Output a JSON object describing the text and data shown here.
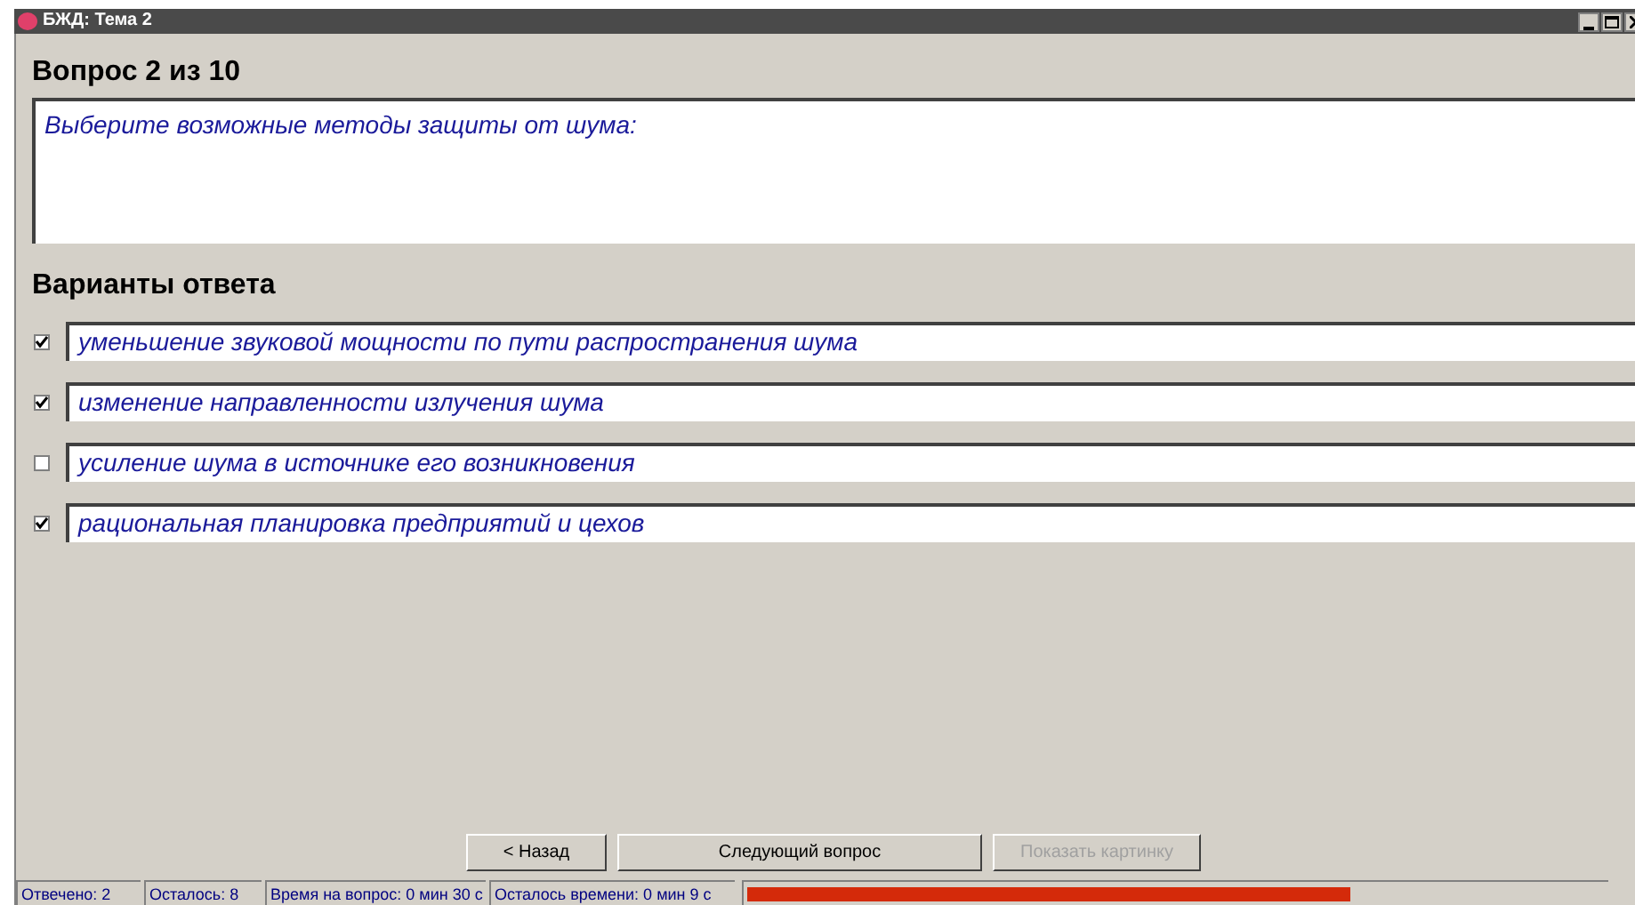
{
  "window": {
    "title": "БЖД: Тема 2"
  },
  "question_header": "Вопрос 2 из 10",
  "question": "Выберите возможные методы защиты от шума:",
  "answers_header": "Варианты ответа",
  "answers": [
    {
      "text": "уменьшение звуковой мощности по пути распространения шума",
      "checked": true
    },
    {
      "text": "изменение направленности излучения шума",
      "checked": true
    },
    {
      "text": "усиление шума в источнике его возникновения",
      "checked": false
    },
    {
      "text": "рациональная планировка предприятий и цехов",
      "checked": true
    }
  ],
  "buttons": [
    {
      "label": "< Назад",
      "disabled": false
    },
    {
      "label": "Следующий вопрос",
      "disabled": false
    },
    {
      "label": "Показать картинку",
      "disabled": true
    }
  ],
  "status_bar": {
    "panels": [
      "Отвечено: 2",
      "Осталось: 8",
      "Время на вопрос: 0 мин 30 с",
      "Осталось времени: 0 мин 9 с"
    ],
    "time_progress": {
      "level": 0.7
    }
  }
}
